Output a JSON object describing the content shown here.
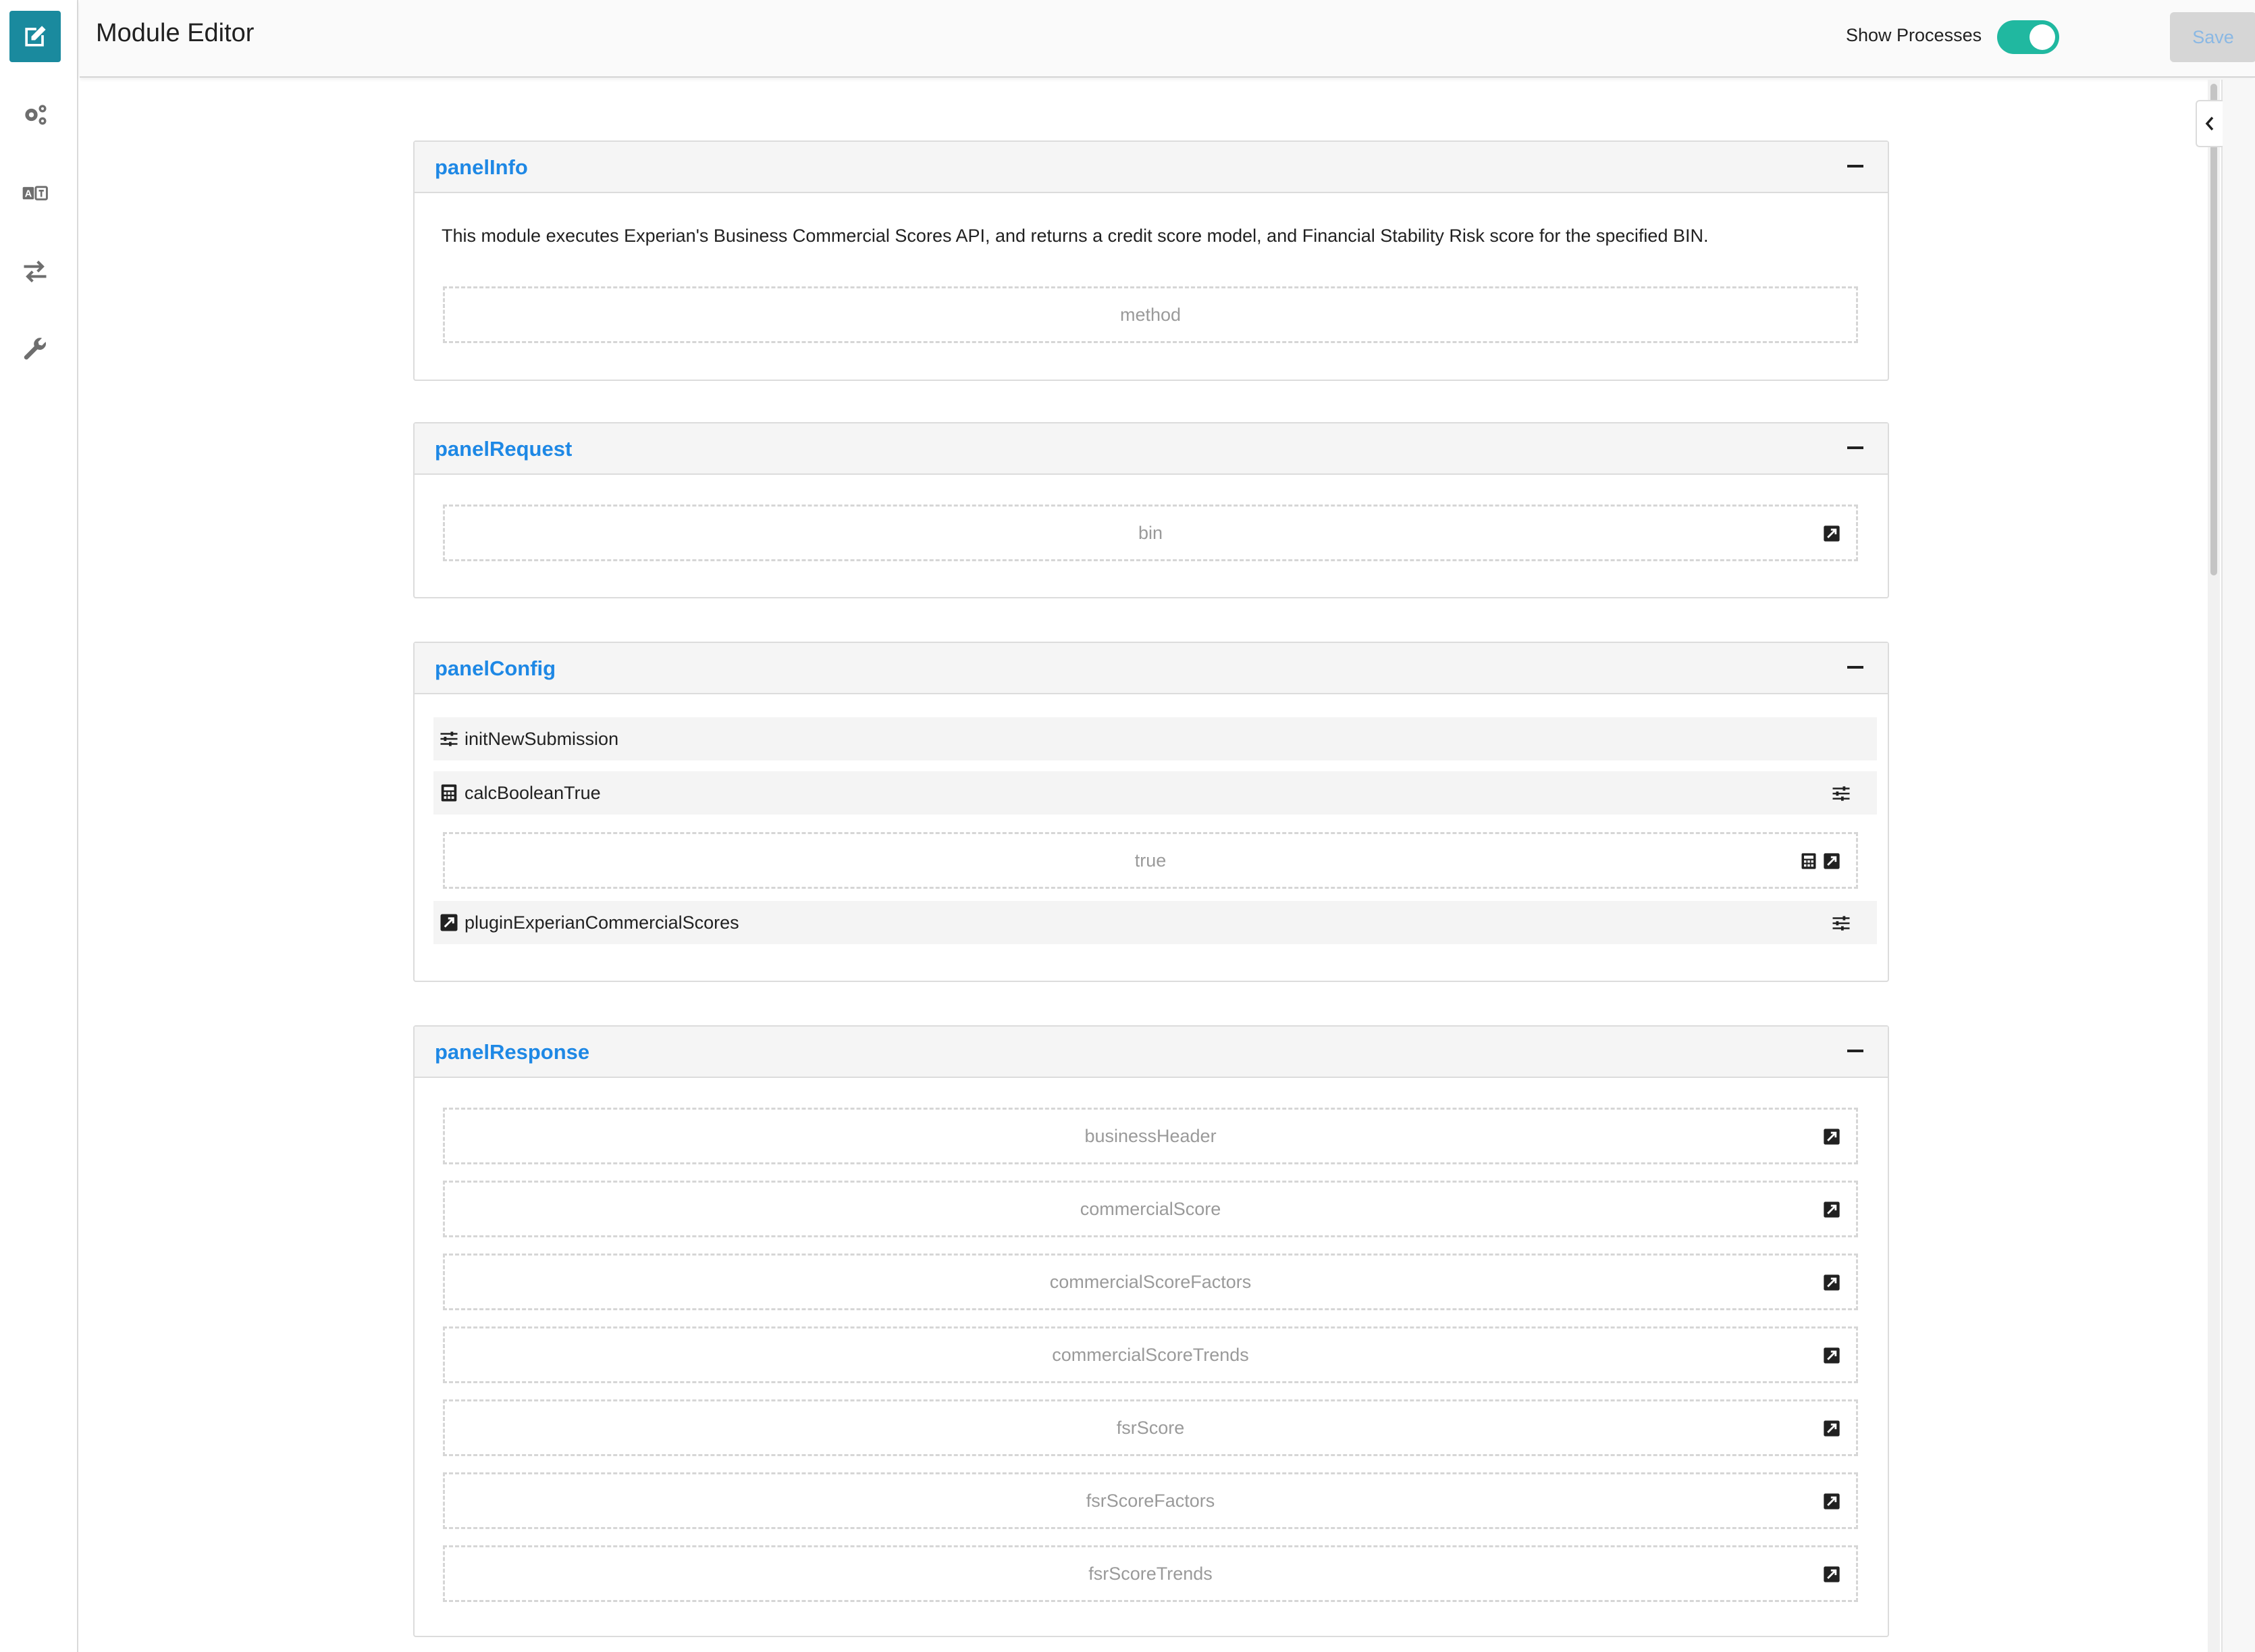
{
  "header": {
    "title": "Module Editor",
    "show_processes_label": "Show Processes",
    "show_processes_on": true,
    "save_label": "Save",
    "more_label": "•••"
  },
  "sidebar": {
    "items": [
      {
        "icon": "edit-icon",
        "active": true
      },
      {
        "icon": "gears-icon",
        "active": false
      },
      {
        "icon": "translate-icon",
        "active": false
      },
      {
        "icon": "transfer-icon",
        "active": false
      },
      {
        "icon": "wrench-icon",
        "active": false
      }
    ]
  },
  "panels": {
    "info": {
      "title": "panelInfo",
      "description": "This module executes Experian's Business Commercial Scores API, and returns a credit score model, and Financial Stability Risk score for the specified BIN.",
      "fields": [
        "method"
      ]
    },
    "request": {
      "title": "panelRequest",
      "fields": [
        "bin"
      ]
    },
    "config": {
      "title": "panelConfig",
      "processes": {
        "init": "initNewSubmission",
        "calc": "calcBooleanTrue",
        "calc_field": "true",
        "plugin": "pluginExperianCommercialScores"
      }
    },
    "response": {
      "title": "panelResponse",
      "fields": [
        "businessHeader",
        "commercialScore",
        "commercialScoreFactors",
        "commercialScoreTrends",
        "fsrScore",
        "fsrScoreFactors",
        "fsrScoreTrends"
      ]
    }
  },
  "colors": {
    "accent": "#1a8a9e",
    "panel_title": "#1e88e5",
    "toggle": "#20b8a0"
  }
}
